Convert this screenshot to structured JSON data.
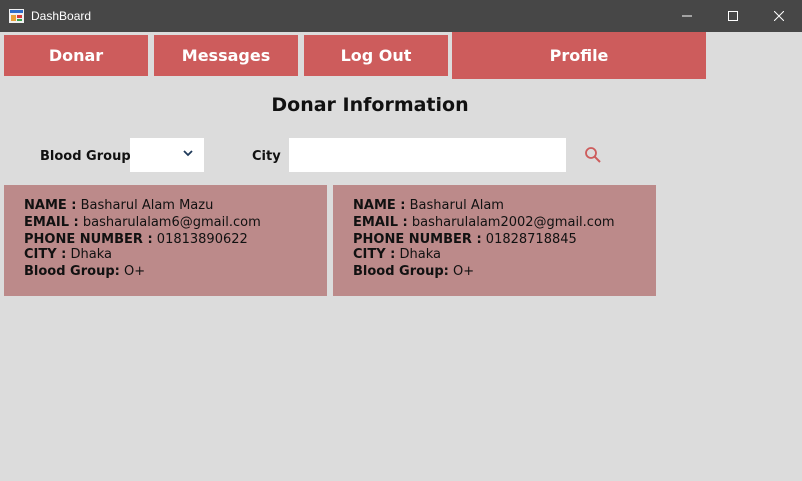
{
  "window": {
    "title": "DashBoard",
    "icons": {
      "app": "dashboard-app-icon",
      "minimize": "minimize-icon",
      "maximize": "maximize-icon",
      "close": "close-icon"
    }
  },
  "nav": {
    "donar": "Donar",
    "messages": "Messages",
    "logout": "Log Out",
    "profile": "Profile"
  },
  "main": {
    "title": "Donar Information",
    "filters": {
      "blood_group_label": "Blood Group",
      "blood_group_value": "",
      "city_label": "City",
      "city_value": "",
      "search_icon": "search-icon"
    },
    "field_labels": {
      "name": "NAME :",
      "email": "EMAIL :",
      "phone": "PHONE NUMBER :",
      "city": "CITY :",
      "blood_group": "Blood Group:"
    },
    "donors": [
      {
        "name": "Basharul Alam Mazu",
        "email": "basharulalam6@gmail.com",
        "phone": "01813890622",
        "city": "Dhaka",
        "blood_group": "O+"
      },
      {
        "name": "Basharul Alam",
        "email": "basharulalam2002@gmail.com",
        "phone": "01828718845",
        "city": "Dhaka",
        "blood_group": "O+"
      }
    ]
  },
  "colors": {
    "titlebar": "#474747",
    "nav_button": "#cd5c5c",
    "card": "#bc8a8a",
    "background": "#dcdcdc",
    "search_icon": "#cd5c5c"
  }
}
